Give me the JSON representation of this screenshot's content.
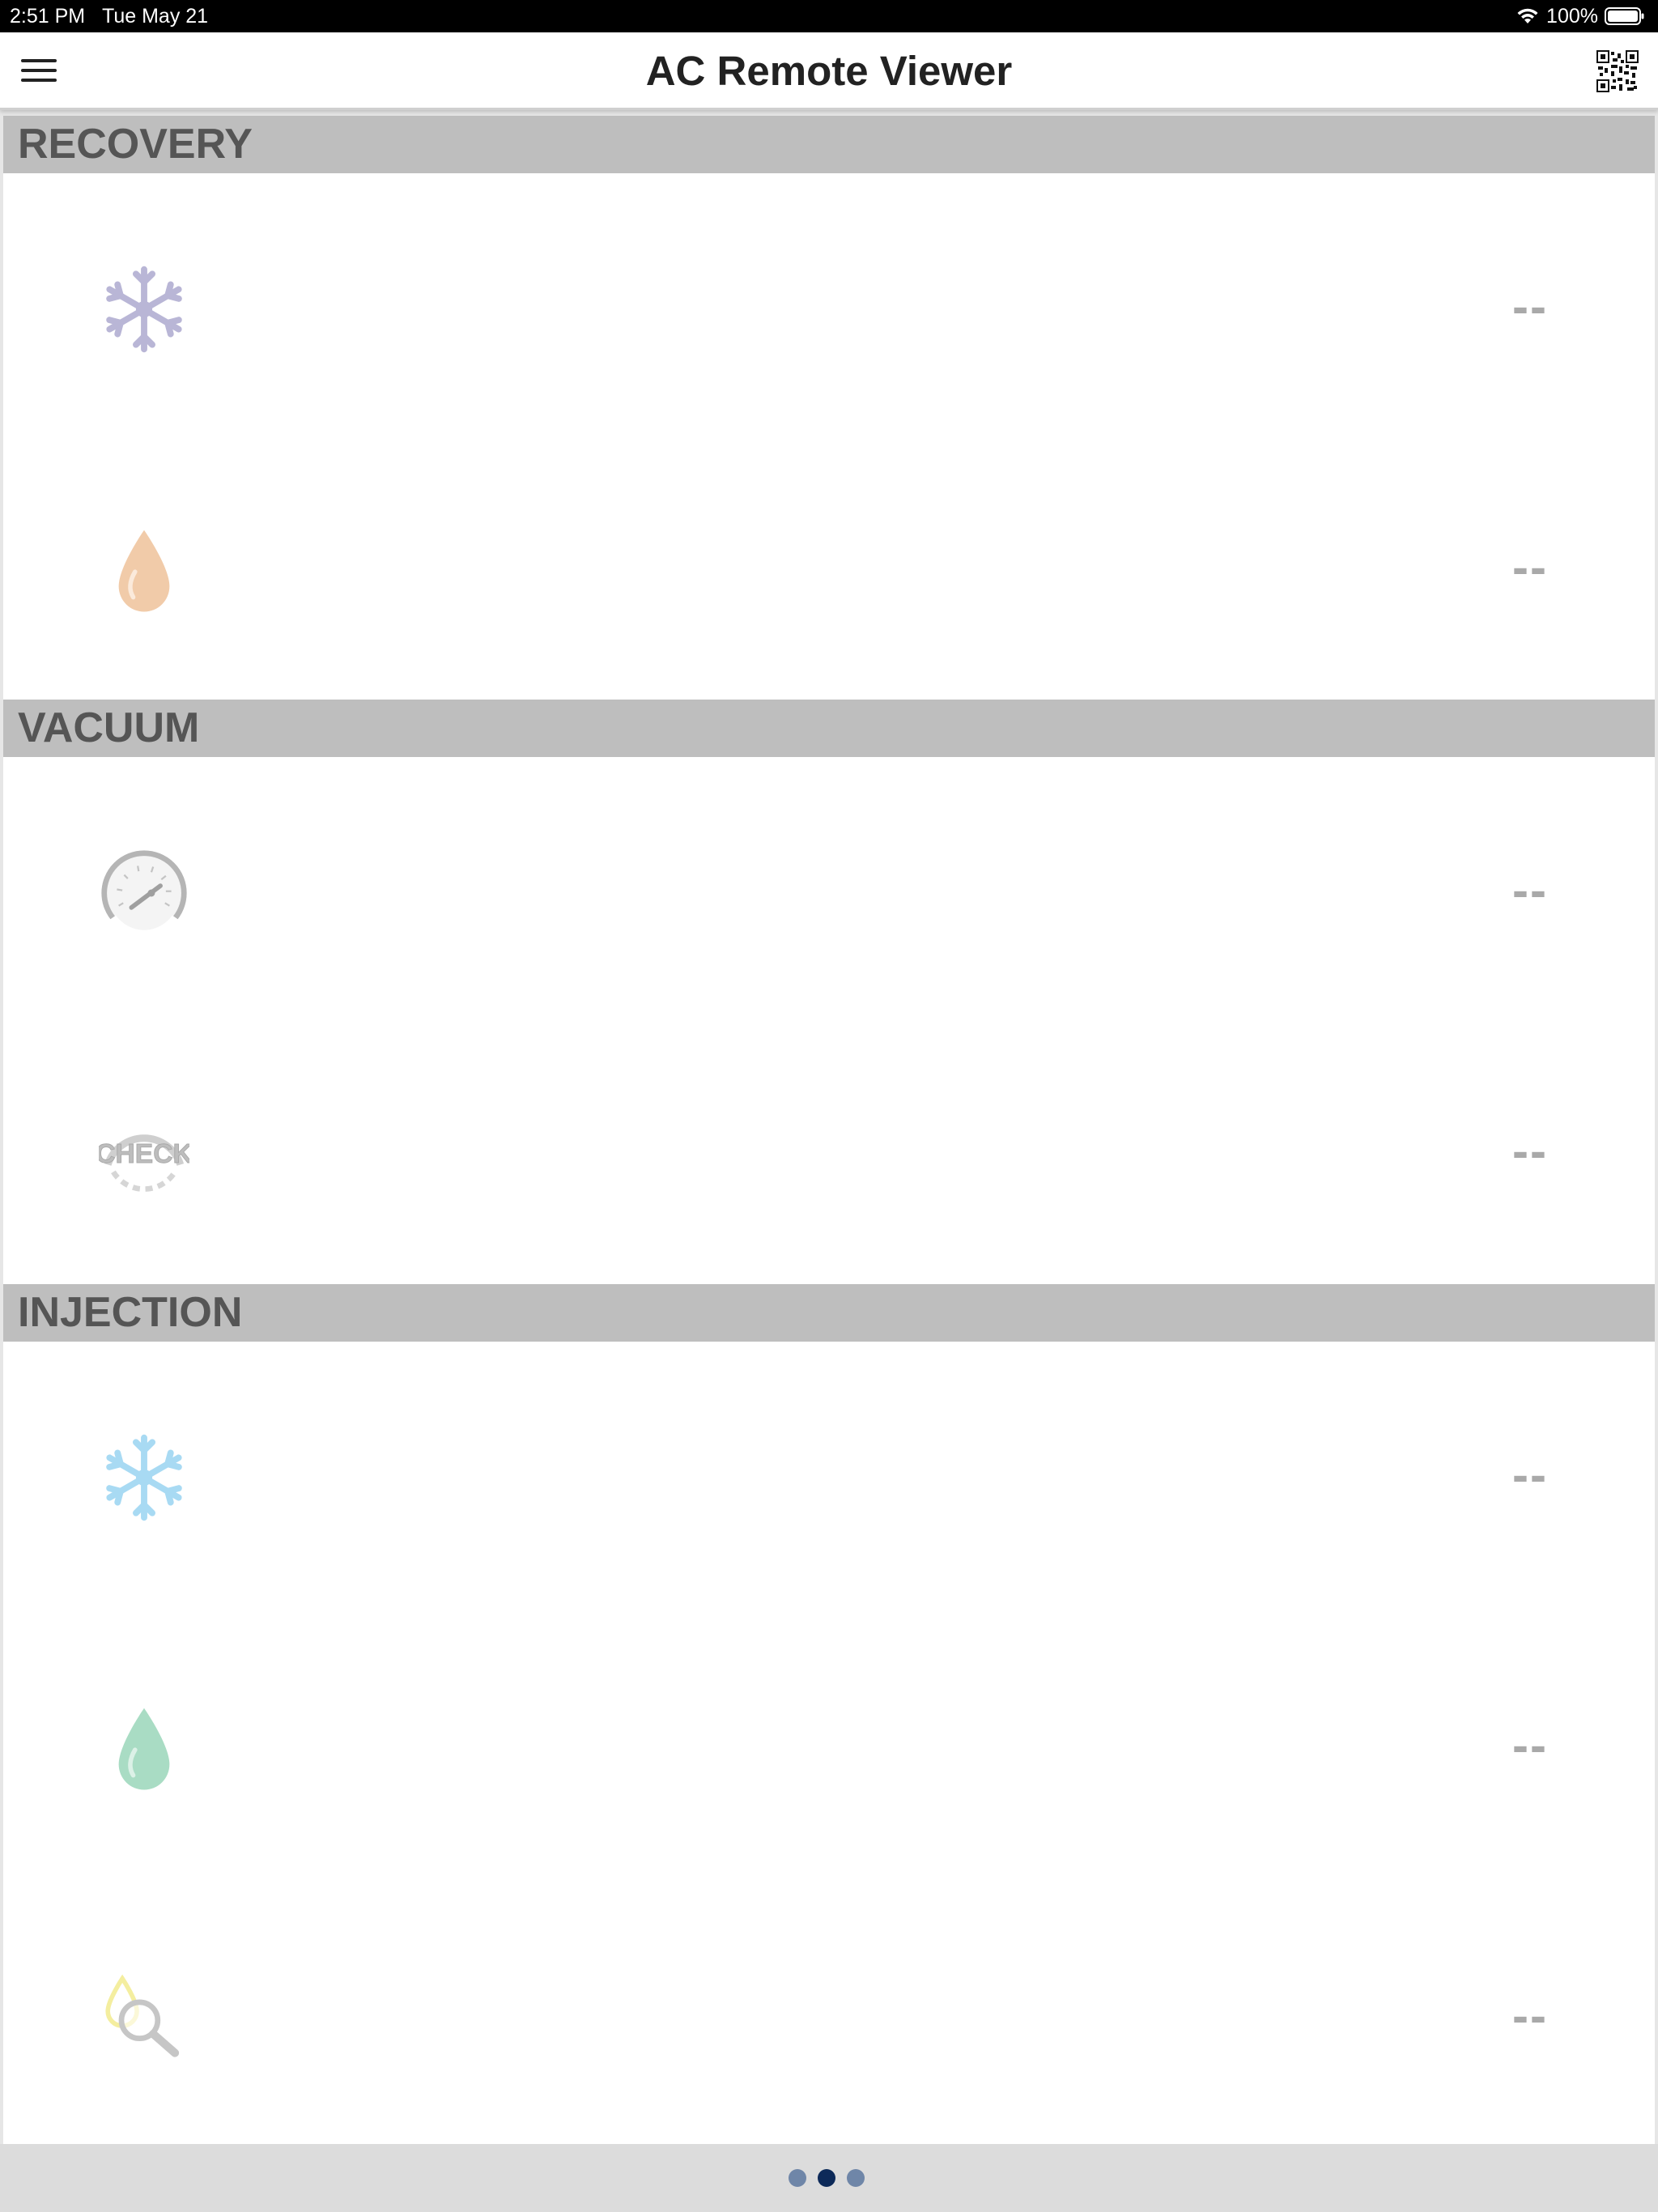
{
  "status_bar": {
    "time": "2:51 PM",
    "date": "Tue May 21",
    "battery": "100%"
  },
  "header": {
    "title": "AC Remote Viewer",
    "left_icon": "hamburger-menu-icon",
    "right_icon": "qr-code-icon"
  },
  "sections": [
    {
      "label": "RECOVERY",
      "rows": [
        {
          "icon": "snowflake-icon",
          "color": "#b9b6d6",
          "value": "--"
        },
        {
          "icon": "oil-drop-icon",
          "color": "#f1cba9",
          "value": "--"
        }
      ]
    },
    {
      "label": "VACUUM",
      "rows": [
        {
          "icon": "vacuum-gauge-icon",
          "color": "#b5b5b5",
          "value": "--"
        },
        {
          "icon": "check-gauge-icon",
          "color": "#c2c2c2",
          "value": "--"
        }
      ]
    },
    {
      "label": "INJECTION",
      "rows": [
        {
          "icon": "snowflake-icon",
          "color": "#a8daf3",
          "value": "--"
        },
        {
          "icon": "oil-drop-icon",
          "color": "#a9dcc4",
          "value": "--"
        },
        {
          "icon": "leak-search-icon",
          "color": "#f4ee9f",
          "value": "--"
        }
      ]
    }
  ],
  "pager": {
    "pages": 3,
    "active": 2
  }
}
